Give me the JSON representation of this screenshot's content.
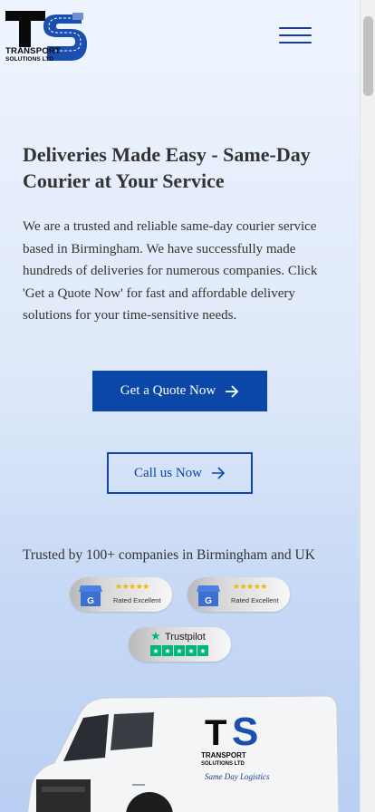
{
  "header": {
    "logo_line1": "TRANSPORT",
    "logo_line2": "SOLUTIONS LTD"
  },
  "hero": {
    "title": "Deliveries Made Easy - Same-Day Courier at Your Service",
    "intro": "We are a trusted and reliable same-day courier service based in Birmingham. We have successfully made hundreds of deliveries for numerous companies. Click 'Get a Quote Now' for fast and affordable delivery solutions for your time-sensitive needs.",
    "quote_button": "Get a Quote Now",
    "call_button": "Call us Now"
  },
  "trust": {
    "text": "Trusted by 100+ companies in Birmingham and UK",
    "google_badges": [
      {
        "stars": "★★★★★",
        "label": "Rated Excellent"
      },
      {
        "stars": "★★★★★",
        "label": "Rated Excellent"
      }
    ],
    "trustpilot": {
      "label": "Trustpilot",
      "star": "★",
      "boxes": [
        "★",
        "★",
        "★",
        "★",
        "★"
      ]
    }
  },
  "van": {
    "logo_line1": "TRANSPORT",
    "logo_line2": "SOLUTIONS LTD",
    "tagline": "Same Day Logistics"
  },
  "icons": {
    "menu": "hamburger-icon",
    "arrow": "arrow-right-icon"
  },
  "colors": {
    "brand_blue": "#0a47a6",
    "logo_blue": "#1a3e8c",
    "text": "#333333",
    "trustpilot_green": "#00b67a"
  }
}
